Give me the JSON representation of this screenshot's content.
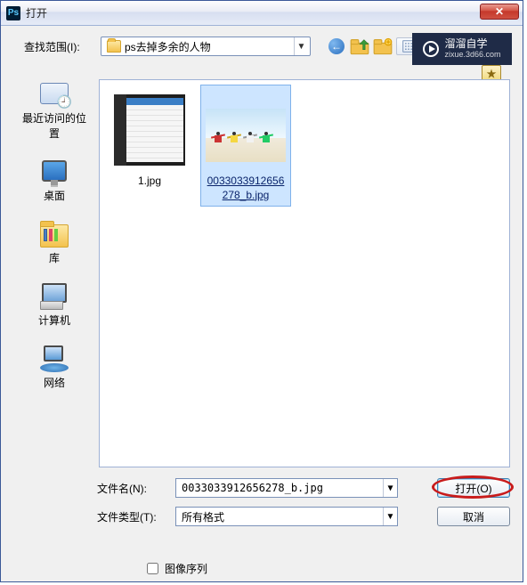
{
  "titlebar": {
    "app_icon_text": "Ps",
    "title": "打开",
    "close_glyph": "✕"
  },
  "lookin": {
    "label": "查找范围(I):",
    "folder": "ps去掉多余的人物"
  },
  "nav": {
    "back": "←",
    "views_dd": "▾"
  },
  "places": {
    "recent": "最近访问的位置",
    "desktop": "桌面",
    "libraries": "库",
    "computer": "计算机",
    "network": "网络"
  },
  "files": [
    {
      "name": "1.jpg",
      "selected": false
    },
    {
      "name": "0033033912656278_b.jpg",
      "selected": true
    }
  ],
  "form": {
    "filename_label": "文件名(N):",
    "filename_value": "0033033912656278_b.jpg",
    "filetype_label": "文件类型(T):",
    "filetype_value": "所有格式",
    "open_btn": "打开(O)",
    "cancel_btn": "取消",
    "sequence_label": "图像序列"
  },
  "watermark": {
    "brand": "溜溜自学",
    "url": "zixue.3d66.com"
  }
}
